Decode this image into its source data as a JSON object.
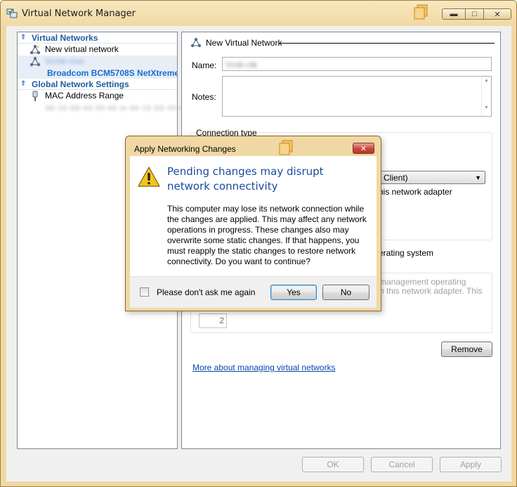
{
  "window": {
    "title": "Virtual Network Manager"
  },
  "tree": {
    "virtual_networks_header": "Virtual Networks",
    "new_network_label": "New virtual network",
    "network_name_redacted": "Vcmk-ctss",
    "adapter_label": "Broadcom BCM5708S NetXtreme",
    "global_settings_header": "Global Network Settings",
    "mac_label": "MAC Address Range",
    "mac_value_redacted": "00-15-5D-00-00-00 to 00-15-5D-00-FF-FF"
  },
  "pane": {
    "header": "New Virtual Network",
    "name_label": "Name:",
    "name_value_redacted": "Vcsk-ctk",
    "notes_label": "Notes:",
    "connection_type_label": "Connection type",
    "combo_fragment": "Client)",
    "adapter_fragment": "his network adapter",
    "os_fragment": "erating system",
    "mgmt_fragment_1": "management operating",
    "mgmt_fragment_2": "n this network adapter. This",
    "vlan_value": "2",
    "remove_button": "Remove",
    "more_link": "More about managing virtual networks"
  },
  "buttons": {
    "ok": "OK",
    "cancel": "Cancel",
    "apply": "Apply"
  },
  "dialog": {
    "title": "Apply Networking Changes",
    "heading": "Pending changes may disrupt network connectivity",
    "message": "This computer may lose its network connection while the changes are applied. This may affect any network operations in progress. These changes also may overwrite some static changes. If that happens, you must reapply the static changes to restore network connectivity. Do you want to continue?",
    "checkbox_label": "Please don't ask me again",
    "checkbox_checked": false,
    "yes": "Yes",
    "no": "No"
  },
  "colors": {
    "frame": "#f0d8a4",
    "section_header": "#1f5ba0",
    "heading_blue": "#1b4b9a",
    "link": "#0645ad"
  }
}
